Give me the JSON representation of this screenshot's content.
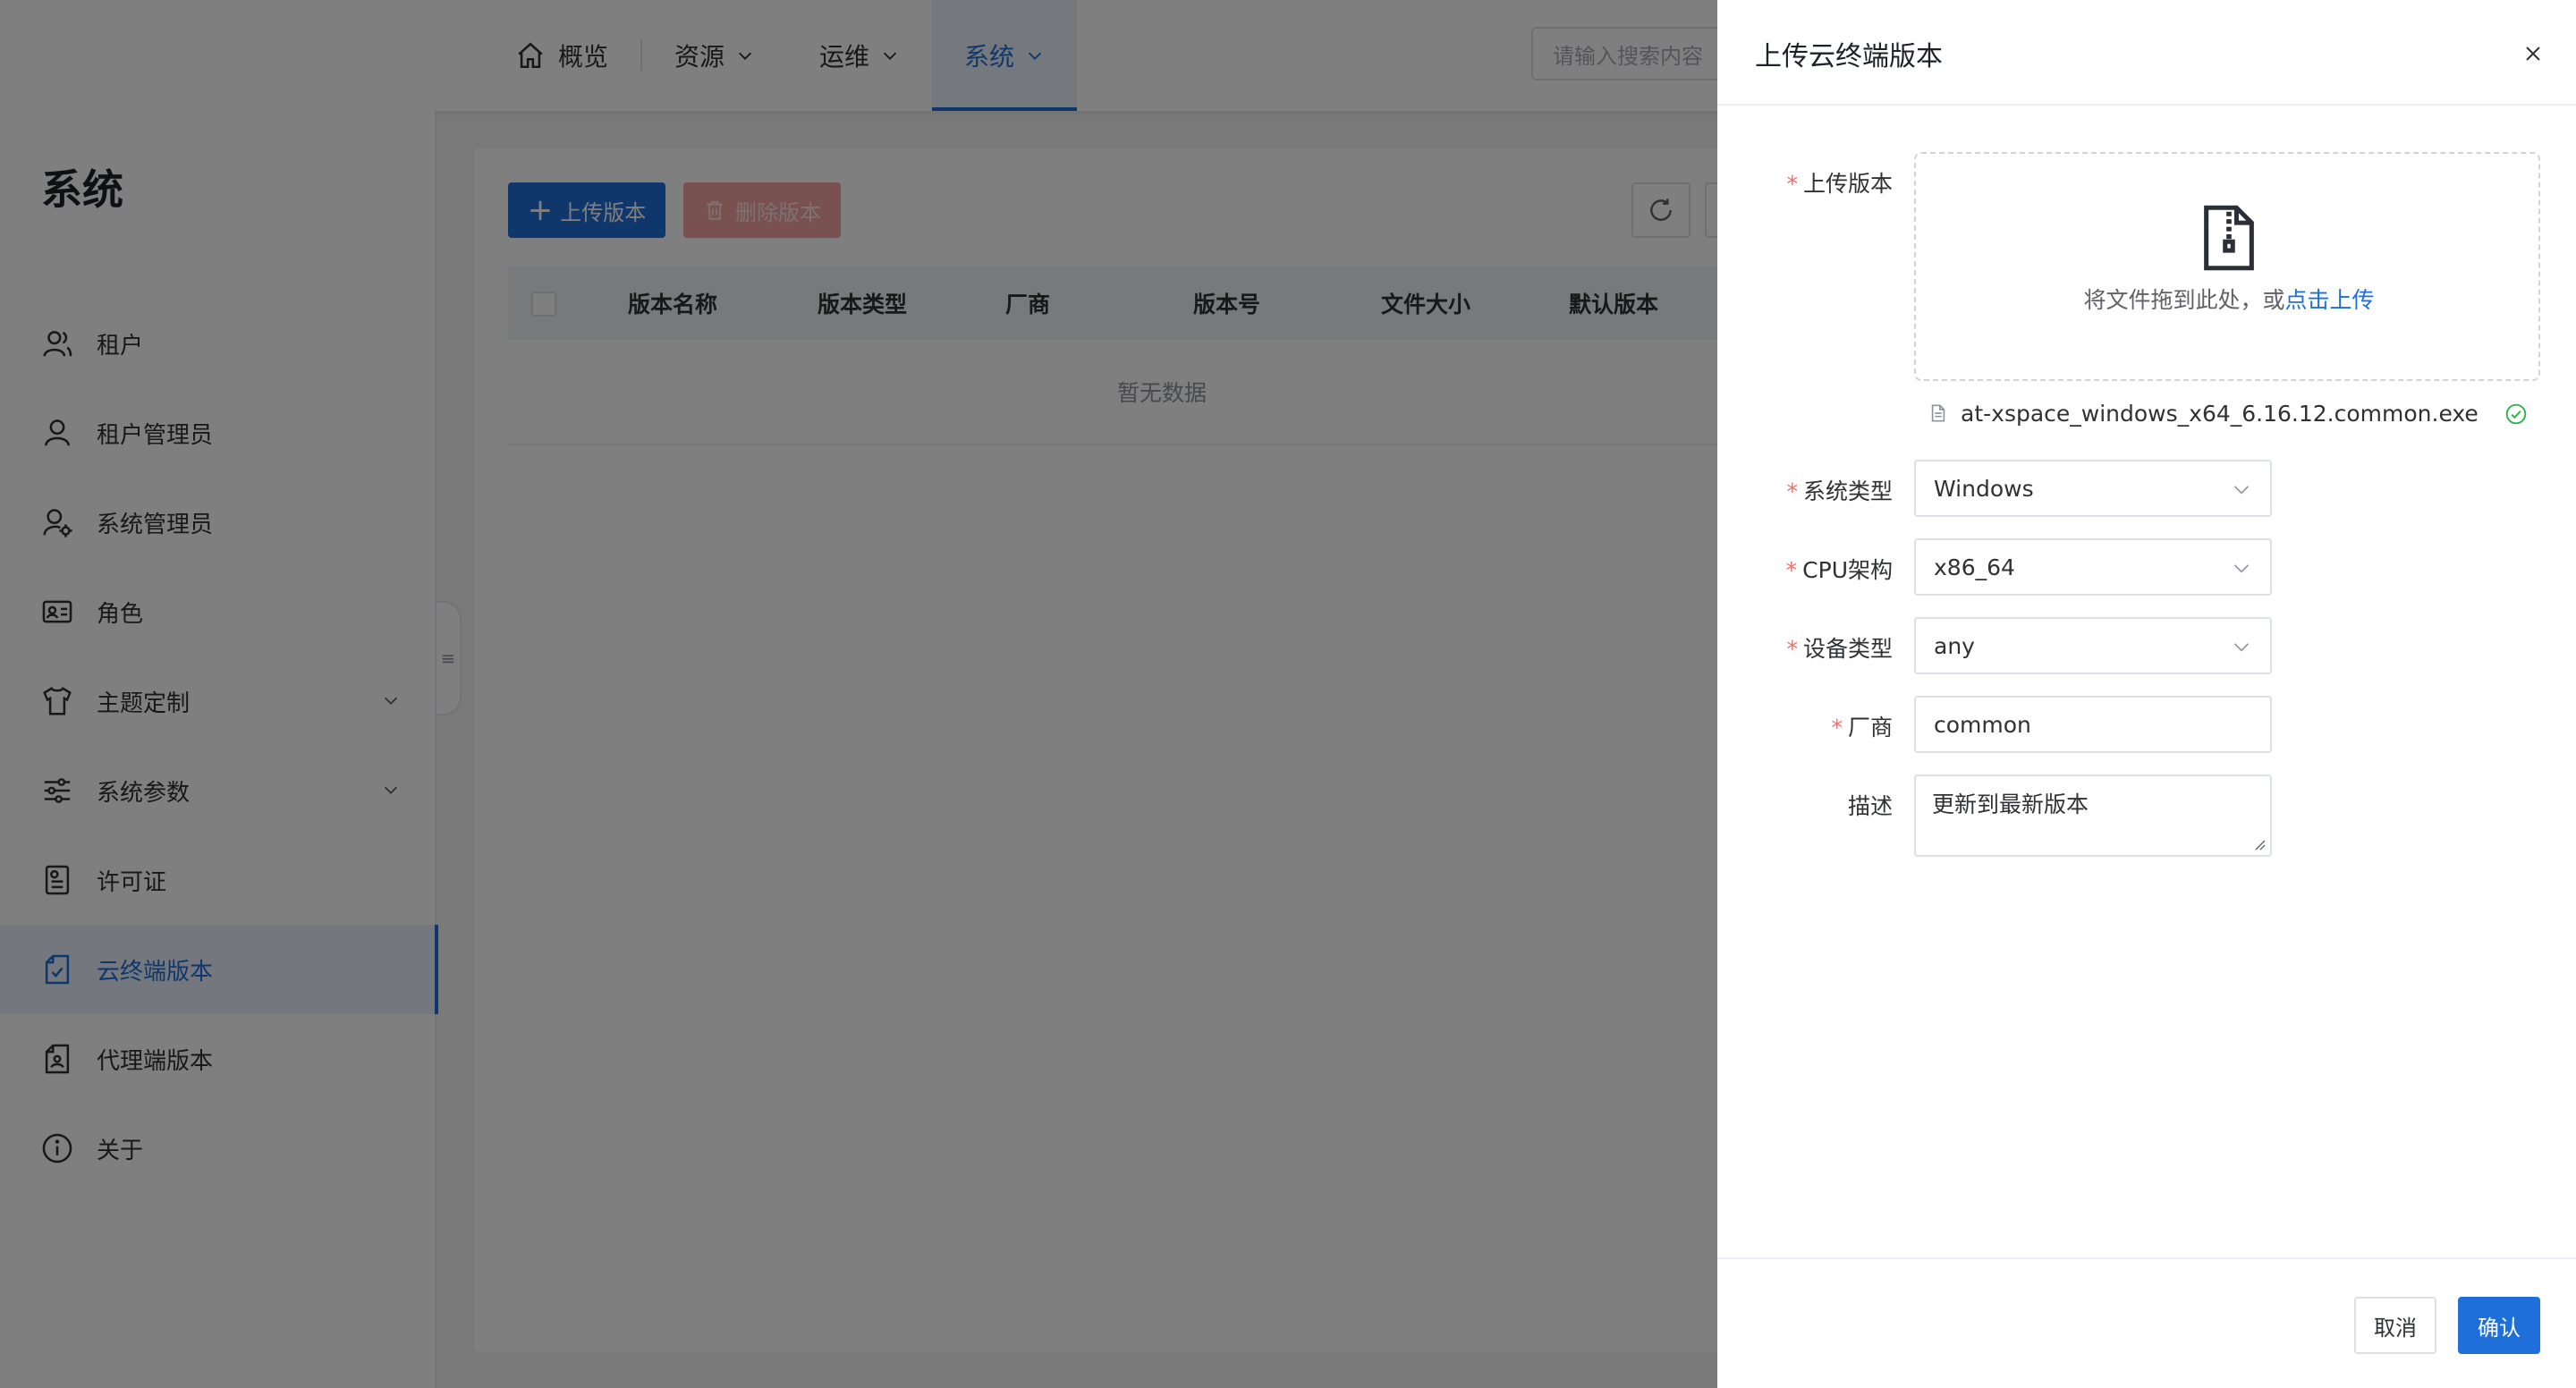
{
  "colors": {
    "primary": "#1e6fd9",
    "danger_disabled": "#f3a3a3",
    "required": "#f56c6c",
    "success": "#2fb34a"
  },
  "topnav": {
    "items": [
      {
        "label": "概览",
        "icon": "home-icon"
      },
      {
        "label": "资源",
        "icon": "chevron-down-icon"
      },
      {
        "label": "运维",
        "icon": "chevron-down-icon"
      },
      {
        "label": "系统",
        "icon": "chevron-down-icon",
        "active": true
      }
    ],
    "search_placeholder": "请输入搜索内容"
  },
  "sidebar": {
    "title": "系统",
    "items": [
      {
        "label": "租户",
        "icon": "users-icon"
      },
      {
        "label": "租户管理员",
        "icon": "user-icon"
      },
      {
        "label": "系统管理员",
        "icon": "user-gear-icon"
      },
      {
        "label": "角色",
        "icon": "id-card-icon"
      },
      {
        "label": "主题定制",
        "icon": "shirt-icon",
        "expandable": true
      },
      {
        "label": "系统参数",
        "icon": "sliders-icon",
        "expandable": true
      },
      {
        "label": "许可证",
        "icon": "license-icon"
      },
      {
        "label": "云终端版本",
        "icon": "cloud-terminal-version-icon",
        "active": true
      },
      {
        "label": "代理端版本",
        "icon": "agent-version-icon"
      },
      {
        "label": "关于",
        "icon": "info-icon"
      }
    ]
  },
  "toolbar": {
    "upload_label": "上传版本",
    "delete_label": "删除版本"
  },
  "table": {
    "columns": [
      "版本名称",
      "版本类型",
      "厂商",
      "版本号",
      "文件大小",
      "默认版本"
    ],
    "empty_text": "暂无数据"
  },
  "drawer": {
    "title": "上传云终端版本",
    "upload": {
      "label": "上传版本",
      "hint": "将文件拖到此处，或",
      "link": "点击上传",
      "file_name": "at-xspace_windows_x64_6.16.12.common.exe"
    },
    "fields": {
      "os_type": {
        "label": "系统类型",
        "value": "Windows"
      },
      "cpu_arch": {
        "label": "CPU架构",
        "value": "x86_64"
      },
      "device_type": {
        "label": "设备类型",
        "value": "any"
      },
      "vendor": {
        "label": "厂商",
        "value": "common"
      },
      "description": {
        "label": "描述",
        "value": "更新到最新版本"
      }
    },
    "cancel_label": "取消",
    "confirm_label": "确认"
  }
}
